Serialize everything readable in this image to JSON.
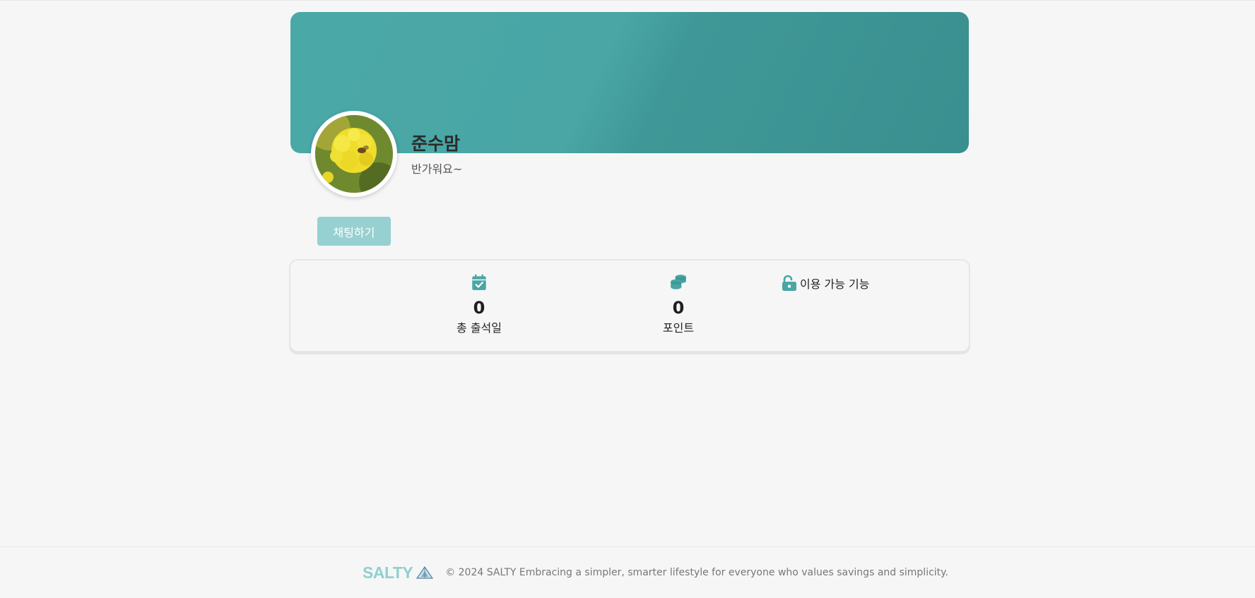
{
  "profile": {
    "nickname": "준수맘",
    "greeting": "반가워요~",
    "avatar_icon": "flower-photo",
    "chat_button_label": "채팅하기"
  },
  "stats": {
    "attendance": {
      "icon": "calendar-check-icon",
      "value": "0",
      "label": "총 출석일"
    },
    "points": {
      "icon": "coins-icon",
      "value": "0",
      "label": "포인트"
    },
    "features": {
      "icon": "unlock-icon",
      "label": "이용 가능 기능"
    }
  },
  "footer": {
    "brand": "SALTY",
    "copyright": "© 2024 SALTY Embracing a simpler, smarter lifestyle for everyone who values savings and simplicity."
  },
  "colors": {
    "accent": "#49a6a5",
    "button": "#97d0d0",
    "brand": "#8fd0cf",
    "background": "#f6f6f6"
  }
}
